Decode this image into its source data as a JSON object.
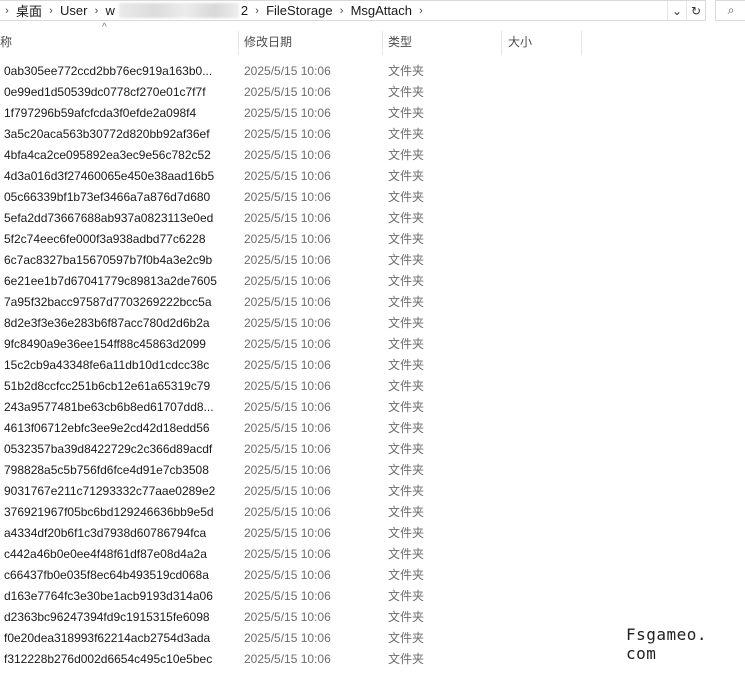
{
  "address_bar": {
    "crumbs": [
      "桌面",
      "User",
      "w",
      "2",
      "FileStorage",
      "MsgAttach"
    ],
    "chevron": "›",
    "dropdown_icon": "⌄",
    "refresh_icon": "↻",
    "search_icon": "⌕"
  },
  "columns": {
    "name": "称",
    "date": "修改日期",
    "type": "类型",
    "size": "大小",
    "sort_caret": "^"
  },
  "rows": [
    {
      "name": "0ab305ee772ccd2bb76ec919a163b0...",
      "date": "2025/5/15 10:06",
      "type": "文件夹"
    },
    {
      "name": "0e99ed1d50539dc0778cf270e01c7f7f",
      "date": "2025/5/15 10:06",
      "type": "文件夹"
    },
    {
      "name": "1f797296b59afcfcda3f0efde2a098f4",
      "date": "2025/5/15 10:06",
      "type": "文件夹"
    },
    {
      "name": "3a5c20aca563b30772d820bb92af36ef",
      "date": "2025/5/15 10:06",
      "type": "文件夹"
    },
    {
      "name": "4bfa4ca2ce095892ea3ec9e56c782c52",
      "date": "2025/5/15 10:06",
      "type": "文件夹"
    },
    {
      "name": "4d3a016d3f27460065e450e38aad16b5",
      "date": "2025/5/15 10:06",
      "type": "文件夹"
    },
    {
      "name": "05c66339bf1b73ef3466a7a876d7d680",
      "date": "2025/5/15 10:06",
      "type": "文件夹"
    },
    {
      "name": "5efa2dd73667688ab937a0823113e0ed",
      "date": "2025/5/15 10:06",
      "type": "文件夹"
    },
    {
      "name": "5f2c74eec6fe000f3a938adbd77c6228",
      "date": "2025/5/15 10:06",
      "type": "文件夹"
    },
    {
      "name": "6c7ac8327ba15670597b7f0b4a3e2c9b",
      "date": "2025/5/15 10:06",
      "type": "文件夹"
    },
    {
      "name": "6e21ee1b7d67041779c89813a2de7605",
      "date": "2025/5/15 10:06",
      "type": "文件夹"
    },
    {
      "name": "7a95f32bacc97587d7703269222bcc5a",
      "date": "2025/5/15 10:06",
      "type": "文件夹"
    },
    {
      "name": "8d2e3f3e36e283b6f87acc780d2d6b2a",
      "date": "2025/5/15 10:06",
      "type": "文件夹"
    },
    {
      "name": "9fc8490a9e36ee154ff88c45863d2099",
      "date": "2025/5/15 10:06",
      "type": "文件夹"
    },
    {
      "name": "15c2cb9a43348fe6a11db10d1cdcc38c",
      "date": "2025/5/15 10:06",
      "type": "文件夹"
    },
    {
      "name": "51b2d8ccfcc251b6cb12e61a65319c79",
      "date": "2025/5/15 10:06",
      "type": "文件夹"
    },
    {
      "name": "243a9577481be63cb6b8ed61707dd8...",
      "date": "2025/5/15 10:06",
      "type": "文件夹"
    },
    {
      "name": "4613f06712ebfc3ee9e2cd42d18edd56",
      "date": "2025/5/15 10:06",
      "type": "文件夹"
    },
    {
      "name": "0532357ba39d8422729c2c366d89acdf",
      "date": "2025/5/15 10:06",
      "type": "文件夹"
    },
    {
      "name": "798828a5c5b756fd6fce4d91e7cb3508",
      "date": "2025/5/15 10:06",
      "type": "文件夹"
    },
    {
      "name": "9031767e211c71293332c77aae0289e2",
      "date": "2025/5/15 10:06",
      "type": "文件夹"
    },
    {
      "name": "376921967f05bc6bd129246636bb9e5d",
      "date": "2025/5/15 10:06",
      "type": "文件夹"
    },
    {
      "name": "a4334df20b6f1c3d7938d60786794fca",
      "date": "2025/5/15 10:06",
      "type": "文件夹"
    },
    {
      "name": "c442a46b0e0ee4f48f61df87e08d4a2a",
      "date": "2025/5/15 10:06",
      "type": "文件夹"
    },
    {
      "name": "c66437fb0e035f8ec64b493519cd068a",
      "date": "2025/5/15 10:06",
      "type": "文件夹"
    },
    {
      "name": "d163e7764fc3e30be1acb9193d314a06",
      "date": "2025/5/15 10:06",
      "type": "文件夹"
    },
    {
      "name": "d2363bc96247394fd9c1915315fe6098",
      "date": "2025/5/15 10:06",
      "type": "文件夹"
    },
    {
      "name": "f0e20dea318993f62214acb2754d3ada",
      "date": "2025/5/15 10:06",
      "type": "文件夹"
    },
    {
      "name": "f312228b276d002d6654c495c10e5bec",
      "date": "2025/5/15 10:06",
      "type": "文件夹"
    }
  ],
  "watermark": "Fsgameo. com"
}
